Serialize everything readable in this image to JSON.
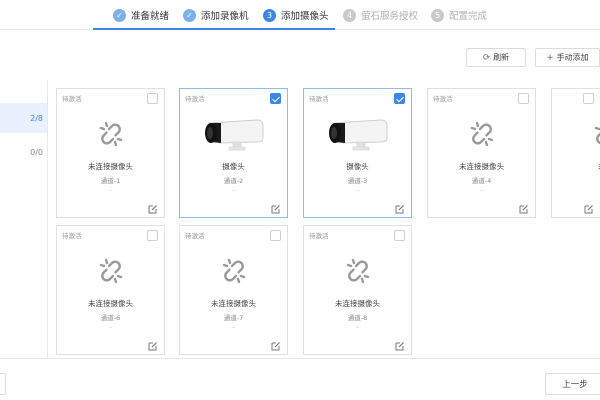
{
  "steps": [
    {
      "label": "准备就绪",
      "marker": "✓",
      "state": "done"
    },
    {
      "label": "添加录像机",
      "marker": "✓",
      "state": "done"
    },
    {
      "label": "添加摄像头",
      "marker": "3",
      "state": "current"
    },
    {
      "label": "萤石服务授权",
      "marker": "4",
      "state": "pending"
    },
    {
      "label": "配置完成",
      "marker": "5",
      "state": "pending"
    }
  ],
  "toolbar": {
    "refresh_label": "刷新",
    "refresh_icon": "refresh-icon",
    "add_label": "手动添加",
    "add_icon": "plus-icon"
  },
  "sidebar": {
    "items": [
      {
        "count": "2/8"
      },
      {
        "count": "0/0"
      }
    ]
  },
  "cards": [
    {
      "status": "待激活",
      "name": "未连接摄像头",
      "channel": "通道-1",
      "dash": "-",
      "checked": false,
      "icon": "broken-link-icon"
    },
    {
      "status": "待激活",
      "name": "摄像头",
      "channel": "通道-2",
      "dash": "-",
      "checked": true,
      "icon": "bullet-camera-icon"
    },
    {
      "status": "待激活",
      "name": "摄像头",
      "channel": "通道-3",
      "dash": "-",
      "checked": true,
      "icon": "bullet-camera-icon"
    },
    {
      "status": "待激活",
      "name": "未连接摄像头",
      "channel": "通道-4",
      "dash": "-",
      "checked": false,
      "icon": "broken-link-icon"
    },
    {
      "status": "",
      "name": "未连",
      "channel": "",
      "dash": "",
      "checked": false,
      "icon": "broken-link-icon"
    },
    {
      "status": "待激活",
      "name": "未连接摄像头",
      "channel": "通道-6",
      "dash": "-",
      "checked": false,
      "icon": "broken-link-icon"
    },
    {
      "status": "待激活",
      "name": "未连接摄像头",
      "channel": "通道-7",
      "dash": "-",
      "checked": false,
      "icon": "broken-link-icon"
    },
    {
      "status": "待激活",
      "name": "未连接摄像头",
      "channel": "通道-8",
      "dash": "-",
      "checked": false,
      "icon": "broken-link-icon"
    }
  ],
  "footer": {
    "prev_label": "上一步"
  },
  "colors": {
    "accent": "#3c87e6",
    "done": "#7ab0ee",
    "pending": "#c9c9c9"
  }
}
